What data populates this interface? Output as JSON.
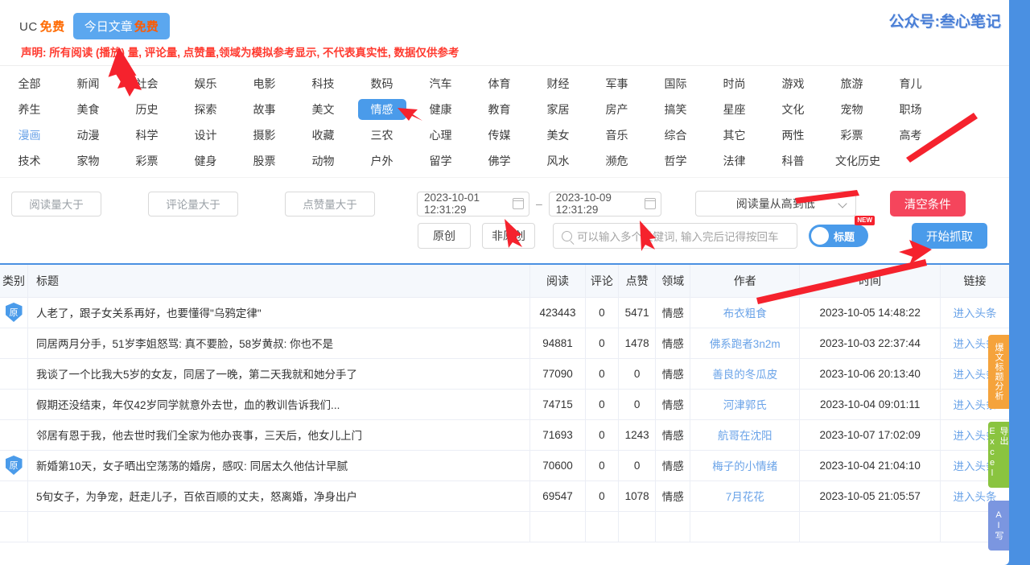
{
  "header": {
    "uc_label": "UC",
    "uc_free": "免费",
    "today_label": "今日文章",
    "today_free": "免费",
    "watermark": "公众号:叁心笔记"
  },
  "notice": "声明: 所有阅读 (播放) 量, 评论量, 点赞量,领域为模拟参考显示, 不代表真实性, 数据仅供参考",
  "categories": {
    "active": "情感",
    "link_style": "漫画",
    "rows": [
      [
        "全部",
        "新闻",
        "社会",
        "娱乐",
        "电影",
        "科技",
        "数码",
        "汽车",
        "体育",
        "财经",
        "军事",
        "国际",
        "时尚",
        "游戏",
        "旅游",
        "育儿"
      ],
      [
        "养生",
        "美食",
        "历史",
        "探索",
        "故事",
        "美文",
        "情感",
        "健康",
        "教育",
        "家居",
        "房产",
        "搞笑",
        "星座",
        "文化",
        "宠物",
        "职场"
      ],
      [
        "漫画",
        "动漫",
        "科学",
        "设计",
        "摄影",
        "收藏",
        "三农",
        "心理",
        "传媒",
        "美女",
        "音乐",
        "综合",
        "其它",
        "两性",
        "彩票",
        "高考"
      ],
      [
        "技术",
        "家物",
        "彩票",
        "健身",
        "股票",
        "动物",
        "户外",
        "留学",
        "佛学",
        "风水",
        "濒危",
        "哲学",
        "法律",
        "科普",
        "文化历史"
      ]
    ]
  },
  "filters": {
    "read_placeholder": "阅读量大于",
    "comment_placeholder": "评论量大于",
    "like_placeholder": "点赞量大于",
    "date_start": "2023-10-01 12:31:29",
    "date_sep": "–",
    "date_end": "2023-10-09 12:31:29",
    "sort_value": "阅读量从高到低",
    "clear_button": "清空条件",
    "original_button": "原创",
    "non_original_button": "非原创",
    "keyword_placeholder": "可以输入多个关键词, 输入完后记得按回车",
    "toggle_label": "标题",
    "toggle_badge": "NEW",
    "start_button": "开始抓取"
  },
  "table": {
    "columns": [
      "类别",
      "标题",
      "阅读",
      "评论",
      "点赞",
      "领域",
      "作者",
      "时间",
      "链接"
    ],
    "original_badge": "原",
    "link_text": "进入头条",
    "rows": [
      {
        "original": true,
        "title": "人老了，跟子女关系再好，也要懂得\"乌鸦定律\"",
        "read": "423443",
        "comment": "0",
        "like": "5471",
        "domain": "情感",
        "author": "布衣粗食",
        "time": "2023-10-05 14:48:22"
      },
      {
        "original": false,
        "title": "同居两月分手，51岁李姐怒骂: 真不要脸，58岁黄叔: 你也不是",
        "read": "94881",
        "comment": "0",
        "like": "1478",
        "domain": "情感",
        "author": "佛系跑者3n2m",
        "time": "2023-10-03 22:37:44"
      },
      {
        "original": false,
        "title": "我谈了一个比我大5岁的女友，同居了一晚，第二天我就和她分手了",
        "read": "77090",
        "comment": "0",
        "like": "0",
        "domain": "情感",
        "author": "善良的冬瓜皮",
        "time": "2023-10-06 20:13:40"
      },
      {
        "original": false,
        "title": "假期还没结束，年仅42岁同学就意外去世，血的教训告诉我们...",
        "read": "74715",
        "comment": "0",
        "like": "0",
        "domain": "情感",
        "author": "河津郭氏",
        "time": "2023-10-04 09:01:11"
      },
      {
        "original": false,
        "title": "邻居有恩于我，他去世时我们全家为他办丧事，三天后，他女儿上门",
        "read": "71693",
        "comment": "0",
        "like": "1243",
        "domain": "情感",
        "author": "航哥在沈阳",
        "time": "2023-10-07 17:02:09"
      },
      {
        "original": true,
        "title": "新婚第10天，女子晒出空荡荡的婚房，感叹: 同居太久他估计早腻",
        "read": "70600",
        "comment": "0",
        "like": "0",
        "domain": "情感",
        "author": "梅子的小情绪",
        "time": "2023-10-04 21:04:10"
      },
      {
        "original": false,
        "title": "5旬女子，为争宠，赶走儿子，百依百顺的丈夫，怒离婚，净身出户",
        "read": "69547",
        "comment": "0",
        "like": "1078",
        "domain": "情感",
        "author": "7月花花",
        "time": "2023-10-05 21:05:57"
      }
    ]
  },
  "sidetabs": [
    {
      "name": "hot-title-analysis",
      "label": "爆文标题分析",
      "color": "#f5a33c"
    },
    {
      "name": "export-excel",
      "label": "导出Excel",
      "color": "#8ac440"
    },
    {
      "name": "ai-writing",
      "label": "AI写",
      "color": "#7b96e0"
    }
  ]
}
